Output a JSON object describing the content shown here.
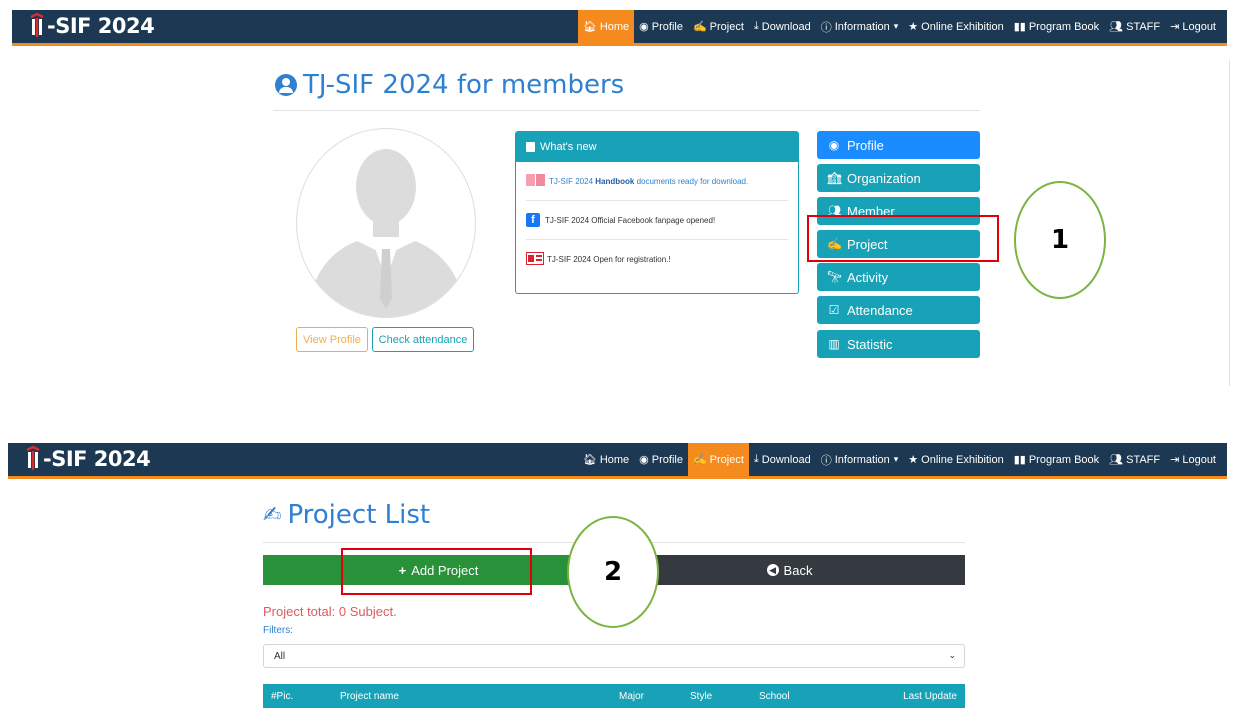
{
  "brand": {
    "logo_text": "-SIF 2024"
  },
  "top": {
    "nav": [
      {
        "label": "Home",
        "icon": "home-icon",
        "glyph": "🏠︎"
      },
      {
        "label": "Profile",
        "icon": "user-circle-icon",
        "glyph": "◉"
      },
      {
        "label": "Project",
        "icon": "compass-icon",
        "glyph": "✍"
      },
      {
        "label": "Download",
        "icon": "download-icon",
        "glyph": "⤓"
      },
      {
        "label": "Information",
        "icon": "info-icon",
        "glyph": "ⓘ",
        "caret": "▾"
      },
      {
        "label": "Online Exhibition",
        "icon": "star-icon",
        "glyph": "★"
      },
      {
        "label": "Program Book",
        "icon": "book-icon",
        "glyph": "▮▮"
      },
      {
        "label": "STAFF",
        "icon": "users-icon",
        "glyph": "👥︎"
      },
      {
        "label": "Logout",
        "icon": "logout-icon",
        "glyph": "⇥"
      }
    ],
    "active": "Home",
    "title": "TJ-SIF 2024 for members",
    "profile_buttons": {
      "view": "View Profile",
      "attendance": "Check attendance"
    },
    "whats_new": {
      "header": "What's new",
      "items": [
        {
          "prefix": "TJ-SIF 2024 ",
          "bold": "Handbook",
          "suffix": " documents ready for download."
        },
        {
          "prefix": "TJ-SIF 2024 Official Facebook fanpage opened!",
          "bold": "",
          "suffix": ""
        },
        {
          "prefix": "TJ-SIF 2024 Open for registration.!",
          "bold": "",
          "suffix": ""
        }
      ]
    },
    "menu": [
      {
        "label": "Profile",
        "glyph": "◉"
      },
      {
        "label": "Organization",
        "glyph": "🏫︎"
      },
      {
        "label": "Member",
        "glyph": "👥︎"
      },
      {
        "label": "Project",
        "glyph": "✍"
      },
      {
        "label": "Activity",
        "glyph": "🔭︎"
      },
      {
        "label": "Attendance",
        "glyph": "☑"
      },
      {
        "label": "Statistic",
        "glyph": "▥"
      }
    ],
    "callout": "1"
  },
  "bottom": {
    "nav": [
      {
        "label": "Home",
        "glyph": "🏠︎"
      },
      {
        "label": "Profile",
        "glyph": "◉"
      },
      {
        "label": "Project",
        "glyph": "✍"
      },
      {
        "label": "Download",
        "glyph": "⤓"
      },
      {
        "label": "Information",
        "glyph": "ⓘ",
        "caret": "▾"
      },
      {
        "label": "Online Exhibition",
        "glyph": "★"
      },
      {
        "label": "Program Book",
        "glyph": "▮▮"
      },
      {
        "label": "STAFF",
        "glyph": "👥︎"
      },
      {
        "label": "Logout",
        "glyph": "⇥"
      }
    ],
    "active": "Project",
    "title": "Project List",
    "add_label": "Add Project",
    "back_label": "Back",
    "total_text": "Project total: 0 Subject.",
    "filters_label": "Filters:",
    "filter_value": "All",
    "columns": [
      "#Pic.",
      "Project name",
      "Major",
      "Style",
      "School",
      "Last Update"
    ],
    "callout": "2"
  },
  "colors": {
    "navy": "#1c3852",
    "orange": "#f58a1f",
    "teal": "#17a2b8",
    "blue": "#1a8cff",
    "green": "#28913a",
    "dark": "#343a40",
    "red": "#e0000a"
  }
}
